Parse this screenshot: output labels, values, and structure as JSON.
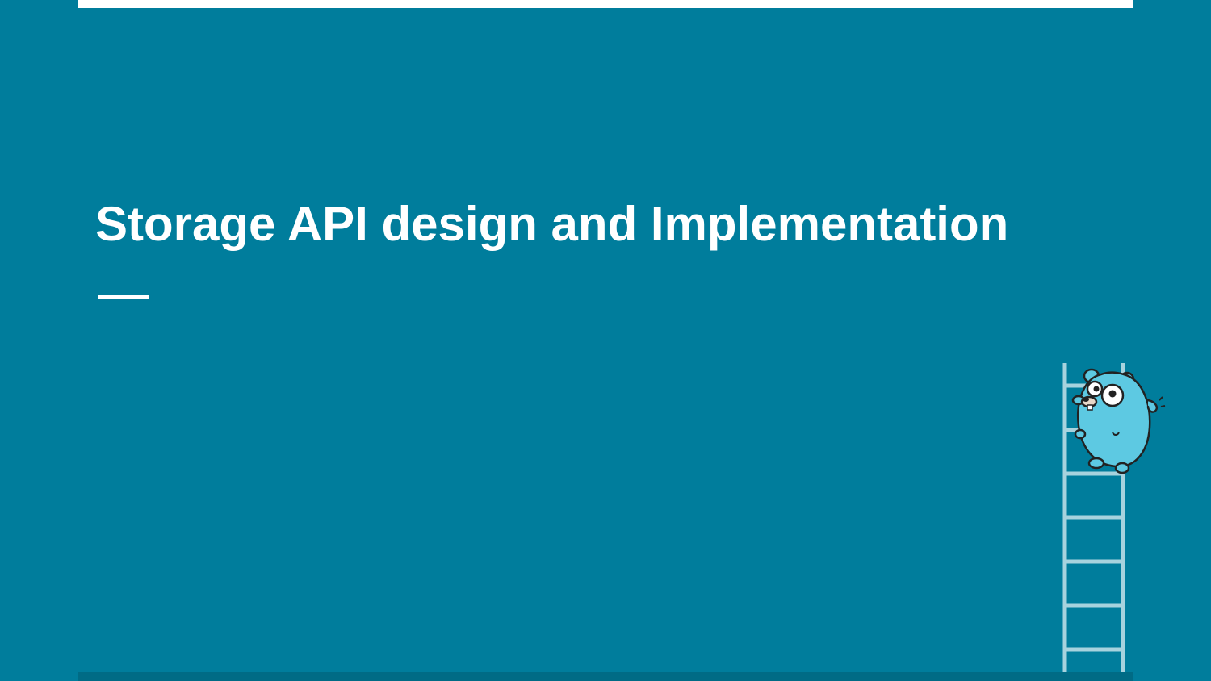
{
  "slide": {
    "title": "Storage API design and Implementation"
  },
  "colors": {
    "background": "#007d9c",
    "title_text": "#ffffff",
    "accent_bar": "#ffffff",
    "bottom_bar": "#006b85",
    "ladder": "#a7d3de",
    "gopher_body": "#5dc9e2",
    "gopher_outline": "#222222"
  },
  "icons": {
    "mascot": "gopher-icon",
    "ladder": "ladder-icon"
  }
}
